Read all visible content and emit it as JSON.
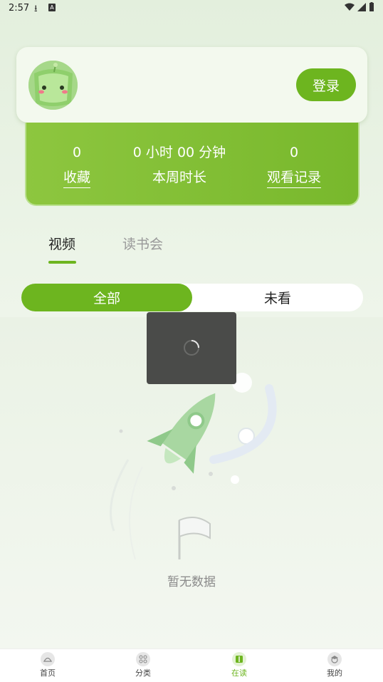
{
  "status_bar": {
    "time": "2:57"
  },
  "profile": {
    "login_label": "登录"
  },
  "stats": [
    {
      "value": "0",
      "label": "收藏"
    },
    {
      "value": "0 小时 00 分钟",
      "label": "本周时长"
    },
    {
      "value": "0",
      "label": "观看记录"
    }
  ],
  "tabs": {
    "video": "视频",
    "reading": "读书会"
  },
  "segment": {
    "all": "全部",
    "unwatched": "未看"
  },
  "empty": {
    "text": "暂无数据"
  },
  "nav": [
    {
      "label": "首页",
      "icon": "home-icon"
    },
    {
      "label": "分类",
      "icon": "grid-icon"
    },
    {
      "label": "在读",
      "icon": "book-icon"
    },
    {
      "label": "我的",
      "icon": "profile-icon"
    }
  ],
  "colors": {
    "accent": "#6db51f",
    "background": "#eef5ea",
    "loading_overlay": "#4a4b49"
  }
}
